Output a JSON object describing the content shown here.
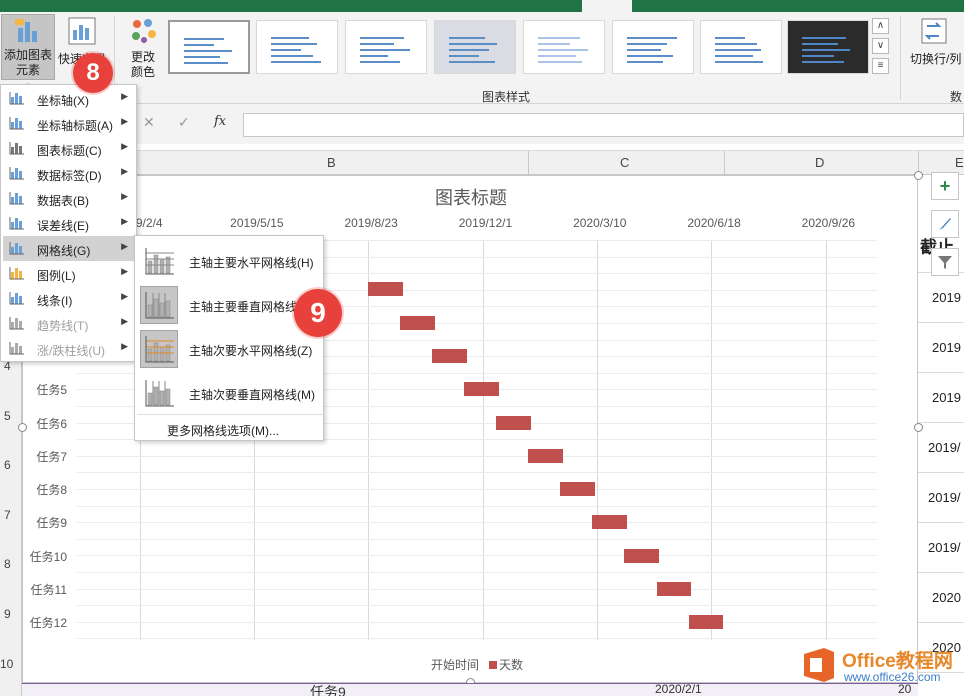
{
  "ribbon": {
    "add_element_label": "添加图表元素",
    "quick_layout_label": "快速布局",
    "change_color_label": "更改颜色",
    "chart_styles_group": "图表样式",
    "switch_row_col_label": "切换行/列",
    "data_group_partial": "数"
  },
  "formula_bar": {
    "cancel": "✕",
    "enter": "✓",
    "fx": "fx"
  },
  "columns": [
    "B",
    "C",
    "D",
    "E"
  ],
  "rows": [
    "4",
    "5",
    "6",
    "7",
    "8",
    "9",
    "10"
  ],
  "right_cells": [
    "截止",
    "2019",
    "2019",
    "2019",
    "2019/",
    "2019/",
    "2019/",
    "2020",
    "2020"
  ],
  "chart": {
    "title": "图表标题",
    "legend": [
      "开始时间",
      "天数"
    ],
    "colors": {
      "bar": "#c0504d",
      "grid": "#d9d9d9"
    }
  },
  "chart_data": {
    "type": "bar",
    "title": "图表标题",
    "x_tick_labels": [
      "2019/2/4",
      "2019/5/15",
      "2019/8/23",
      "2019/12/1",
      "2020/3/10",
      "2020/6/18",
      "2020/9/26"
    ],
    "categories_visible": [
      "任务5",
      "任务6",
      "任务7",
      "任务8",
      "任务9",
      "任务10",
      "任务11",
      "任务12"
    ],
    "series": [
      {
        "name": "开始时间",
        "stacked": true,
        "visible": false
      },
      {
        "name": "天数",
        "stacked": true,
        "color": "#c0504d"
      }
    ],
    "bars_start": [
      "2019/8/23",
      "2019/9/20",
      "2019/10/18",
      "2019/11/15",
      "2019/12/13",
      "2020/1/10",
      "2020/2/7",
      "2020/3/6",
      "2020/4/3",
      "2020/5/1",
      "2020/5/29"
    ],
    "bars_days": [
      30,
      30,
      30,
      30,
      30,
      30,
      30,
      30,
      30,
      30,
      30
    ],
    "legend_position": "bottom",
    "vertical_grid": true,
    "horizontal_grid": true
  },
  "menu": {
    "items": [
      {
        "label": "坐标轴(X)",
        "icon": "axis-icon",
        "disabled": false
      },
      {
        "label": "坐标轴标题(A)",
        "icon": "axis-title-icon",
        "disabled": false
      },
      {
        "label": "图表标题(C)",
        "icon": "chart-title-icon",
        "disabled": false
      },
      {
        "label": "数据标签(D)",
        "icon": "data-labels-icon",
        "disabled": false
      },
      {
        "label": "数据表(B)",
        "icon": "data-table-icon",
        "disabled": false
      },
      {
        "label": "误差线(E)",
        "icon": "error-bars-icon",
        "disabled": false
      },
      {
        "label": "网格线(G)",
        "icon": "gridlines-icon",
        "disabled": false
      },
      {
        "label": "图例(L)",
        "icon": "legend-icon",
        "disabled": false
      },
      {
        "label": "线条(I)",
        "icon": "lines-icon",
        "disabled": false
      },
      {
        "label": "趋势线(T)",
        "icon": "trendline-icon",
        "disabled": true
      },
      {
        "label": "涨/跌柱线(U)",
        "icon": "up-down-bars-icon",
        "disabled": true
      }
    ]
  },
  "submenu": {
    "items": [
      {
        "label": "主轴主要水平网格线(H)",
        "selected": false
      },
      {
        "label": "主轴主要垂直网格线(V)",
        "selected": true
      },
      {
        "label": "主轴次要水平网格线(Z)",
        "selected": true
      },
      {
        "label": "主轴次要垂直网格线(M)",
        "selected": false
      }
    ],
    "more": "更多网格线选项(M)..."
  },
  "badges": [
    "8",
    "9"
  ],
  "bottom_row": {
    "task": "任务9",
    "date": "2020/2/1",
    "extra": "20"
  },
  "watermark": {
    "brand": "Office教程网",
    "url": "www.office26.com"
  }
}
